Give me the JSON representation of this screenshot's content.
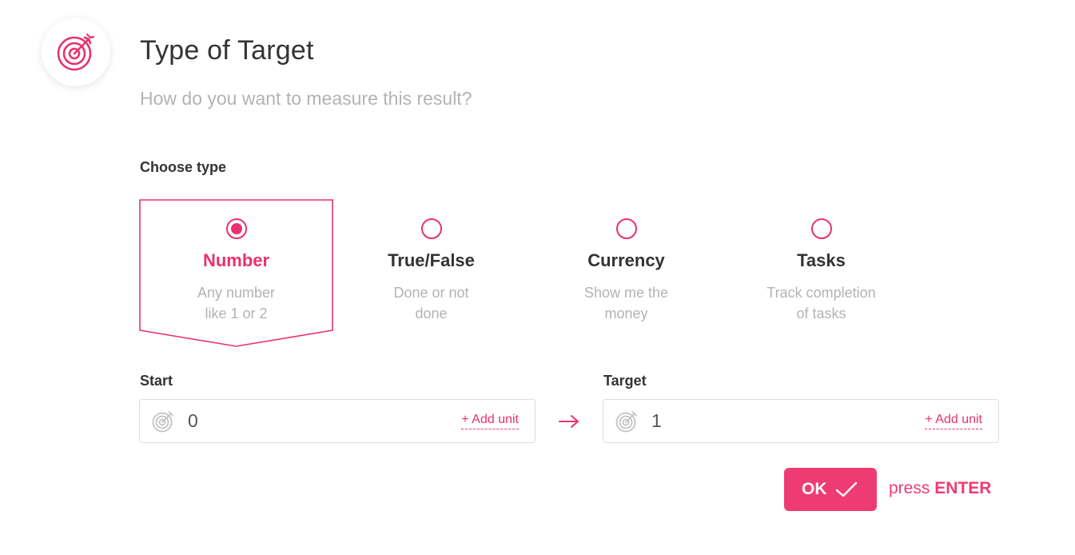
{
  "header": {
    "icon": "target-icon",
    "title": "Type of Target",
    "subtitle": "How do you want to measure this result?"
  },
  "choose_type": {
    "label": "Choose type",
    "selected": "Number",
    "options": [
      {
        "name": "Number",
        "desc_line1": "Any number",
        "desc_line2": "like 1 or 2",
        "selected": true
      },
      {
        "name": "True/False",
        "desc_line1": "Done or not",
        "desc_line2": "done",
        "selected": false
      },
      {
        "name": "Currency",
        "desc_line1": "Show me the",
        "desc_line2": "money",
        "selected": false
      },
      {
        "name": "Tasks",
        "desc_line1": "Track completion",
        "desc_line2": "of tasks",
        "selected": false
      }
    ]
  },
  "start": {
    "label": "Start",
    "icon": "target-icon",
    "value": "0",
    "add_unit": "+ Add unit"
  },
  "target": {
    "label": "Target",
    "icon": "target-icon",
    "value": "1",
    "add_unit": "+ Add unit"
  },
  "arrow_icon": "arrow-right-icon",
  "ok_button": {
    "label": "OK",
    "icon": "check-icon"
  },
  "hint": {
    "prefix": "press",
    "key": "ENTER"
  },
  "colors": {
    "accent": "#e8326d",
    "button": "#ef3b73",
    "text_dark": "#333333",
    "text_muted": "#b3b3b3",
    "border": "#dcdcdc"
  }
}
